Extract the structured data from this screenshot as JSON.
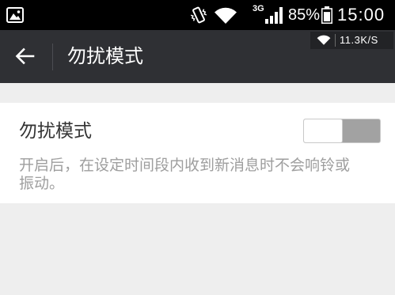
{
  "status_bar": {
    "icons": [
      "gallery-icon",
      "vibrate-icon",
      "wifi-icon",
      "signal-bars-icon",
      "battery-icon"
    ],
    "network_type": "3G",
    "signal_level": 4,
    "battery_level": 0.85,
    "battery_percent": "85%",
    "time": "15:00"
  },
  "app_bar": {
    "back_icon": "arrow-left-icon",
    "title": "勿扰模式"
  },
  "speed_overlay": {
    "icon": "wifi-icon",
    "speed": "11.3K/S"
  },
  "settings": {
    "dnd": {
      "label": "勿扰模式",
      "description": "开启后，在设定时间段内收到新消息时不会响铃或振动。",
      "toggle_on": false
    }
  },
  "colors": {
    "status_bar_bg": "#000000",
    "app_bar_bg": "#2f3034",
    "overlay_bg": "#222326",
    "page_bg": "#eeeeee",
    "card_bg": "#ffffff",
    "label_text": "#333333",
    "description_text": "#9e9e9e",
    "toggle_track": "#a2a2a2",
    "toggle_border": "#c9c9c9"
  }
}
